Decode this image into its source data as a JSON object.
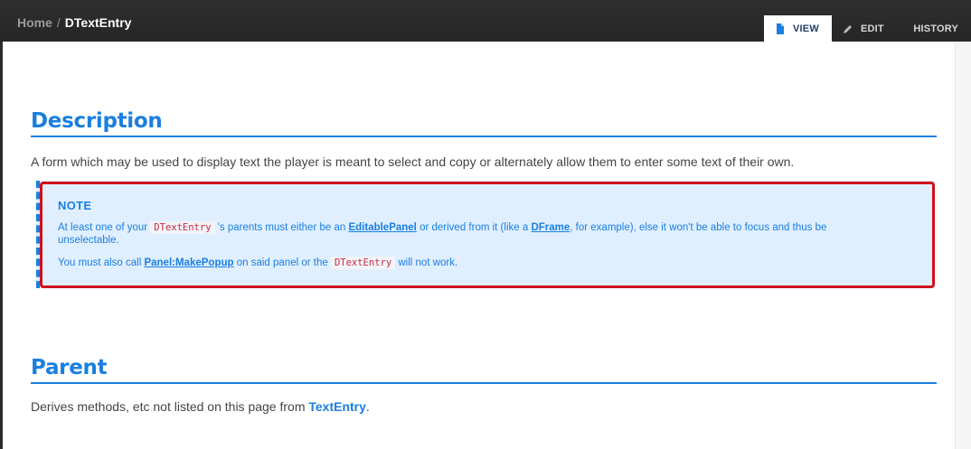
{
  "breadcrumb": {
    "home": "Home",
    "separator": "/",
    "current": "DTextEntry"
  },
  "tabs": [
    {
      "label": "VIEW",
      "icon": "document-icon",
      "active": true
    },
    {
      "label": "EDIT",
      "icon": "pencil-icon",
      "active": false
    },
    {
      "label": "HISTORY",
      "icon": "history-icon",
      "active": false
    }
  ],
  "description": {
    "heading": "Description",
    "text": "A form which may be used to display text the player is meant to select and copy or alternately allow them to enter some text of their own."
  },
  "note": {
    "title": "NOTE",
    "line1_a": "At least one of your ",
    "line1_code": "DTextEntry",
    "line1_b": " 's parents must either be an ",
    "line1_link1": "EditablePanel",
    "line1_c": " or derived from it (like a ",
    "line1_link2": "DFrame",
    "line1_d": ", for example), else it won't be able to focus and thus be unselectable.",
    "line2_a": "You must also call ",
    "line2_link": "Panel:MakePopup",
    "line2_b": " on said panel or the ",
    "line2_code": "DTextEntry",
    "line2_c": " will not work."
  },
  "parent": {
    "heading": "Parent",
    "text": "Derives methods, etc not listed on this page from ",
    "link": "TextEntry",
    "suffix": "."
  },
  "colors": {
    "accent": "#1a7fe0",
    "note_bg": "#e0efff",
    "highlight": "#d0101c",
    "code": "#c72a4a"
  }
}
